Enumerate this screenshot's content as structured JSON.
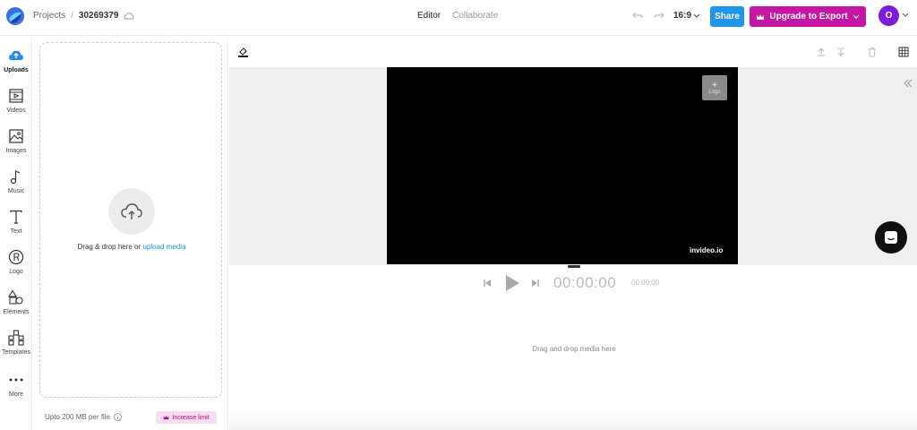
{
  "header": {
    "breadcrumb_root": "Projects",
    "breadcrumb_sep": "/",
    "project_id": "30269379",
    "modes": {
      "editor": "Editor",
      "collaborate": "Collaborate"
    },
    "aspect_ratio": "16:9",
    "share_label": "Share",
    "upgrade_label": "Upgrade to Export",
    "avatar_initial": "O"
  },
  "sidebar": {
    "items": [
      {
        "label": "Uploads",
        "icon": "cloud-upload-icon"
      },
      {
        "label": "Videos",
        "icon": "video-icon"
      },
      {
        "label": "Images",
        "icon": "image-icon"
      },
      {
        "label": "Music",
        "icon": "music-note-icon"
      },
      {
        "label": "Text",
        "icon": "text-icon"
      },
      {
        "label": "Logo",
        "icon": "registered-icon"
      },
      {
        "label": "Elements",
        "icon": "shapes-icon"
      },
      {
        "label": "Templates",
        "icon": "templates-icon"
      },
      {
        "label": "More",
        "icon": "more-dots-icon"
      }
    ]
  },
  "uploads_panel": {
    "drop_text": "Drag & drop here or",
    "drop_link": "upload media",
    "limit_text": "Upto 200 MB per file",
    "increase_label": "Increase limit"
  },
  "canvas": {
    "logo_button_label": "Logo",
    "watermark": "invideo.io"
  },
  "playback": {
    "current_time": "00:00:00",
    "duration": "00:00:00"
  },
  "timeline": {
    "empty_text": "Drag and drop media here"
  },
  "colors": {
    "accent": "#2196e8",
    "upgrade": "#c517a5",
    "avatar": "#7b1fd6"
  }
}
